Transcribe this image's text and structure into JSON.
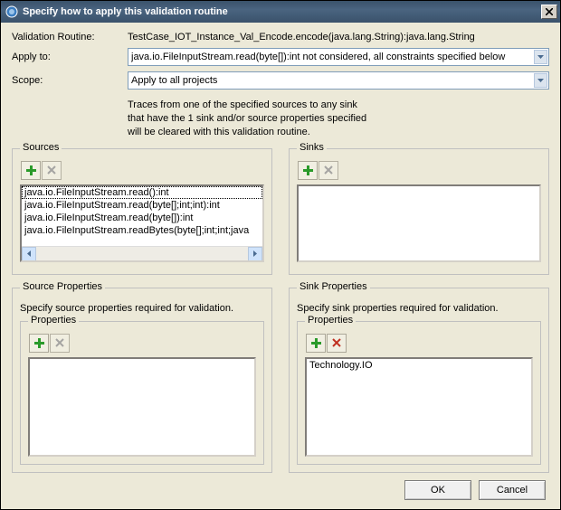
{
  "title": "Specify how to apply this validation routine",
  "labels": {
    "validation_routine": "Validation Routine:",
    "apply_to": "Apply to:",
    "scope": "Scope:"
  },
  "validation_routine_value": "TestCase_IOT_Instance_Val_Encode.encode(java.lang.String):java.lang.String",
  "apply_to_value": "java.io.FileInputStream.read(byte[]):int not considered, all constraints specified below",
  "scope_value": "Apply to all projects",
  "description": "Traces from one of the specified sources to any sink\nthat have the 1 sink and/or source properties specified\nwill be cleared with this validation routine.",
  "panels": {
    "sources": {
      "legend": "Sources",
      "items": [
        "java.io.FileInputStream.read():int",
        "java.io.FileInputStream.read(byte[];int;int):int",
        "java.io.FileInputStream.read(byte[]):int",
        "java.io.FileInputStream.readBytes(byte[];int;int;java"
      ]
    },
    "sinks": {
      "legend": "Sinks",
      "items": []
    },
    "source_props": {
      "legend": "Source Properties",
      "desc": "Specify source properties required for validation.",
      "sublegend": "Properties",
      "items": []
    },
    "sink_props": {
      "legend": "Sink Properties",
      "desc": "Specify sink properties required for validation.",
      "sublegend": "Properties",
      "items": [
        "Technology.IO"
      ]
    }
  },
  "buttons": {
    "ok": "OK",
    "cancel": "Cancel"
  }
}
